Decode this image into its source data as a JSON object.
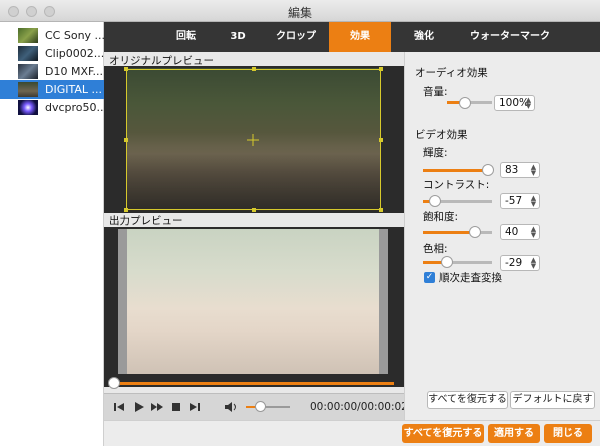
{
  "window": {
    "title": "編集"
  },
  "sidebar": {
    "clips": [
      {
        "name": "CC Sony ...",
        "selected": false
      },
      {
        "name": "Clip0002....",
        "selected": false
      },
      {
        "name": "D10 MXF....",
        "selected": false
      },
      {
        "name": "DIGITAL ...",
        "selected": true
      },
      {
        "name": "dvcpro50....",
        "selected": false
      }
    ]
  },
  "tabs": [
    {
      "label": "回転",
      "active": false
    },
    {
      "label": "3D",
      "active": false
    },
    {
      "label": "クロップ",
      "active": false
    },
    {
      "label": "効果",
      "active": true
    },
    {
      "label": "強化",
      "active": false
    },
    {
      "label": "ウォーターマーク",
      "active": false
    }
  ],
  "preview": {
    "original_label": "オリジナルプレビュー",
    "output_label": "出力プレビュー",
    "scrub_position_percent": 0,
    "volume_percent": 30,
    "timecode": "00:00:00/00:00:02"
  },
  "audio": {
    "section_title": "オーディオ効果",
    "volume_label": "音量:",
    "volume_value": "100%"
  },
  "video": {
    "section_title": "ビデオ効果",
    "brightness_label": "輝度:",
    "brightness_value": "83",
    "contrast_label": "コントラスト:",
    "contrast_value": "-57",
    "saturation_label": "飽和度:",
    "saturation_value": "40",
    "hue_label": "色相:",
    "hue_value": "-29",
    "deinterlace_label": "順次走査変換",
    "deinterlace_checked": true
  },
  "panel_buttons": {
    "restore_all": "すべてを復元する",
    "default_restore": "デフォルトに戻す"
  },
  "footer": {
    "restore_all": "すべてを復元する",
    "apply": "適用する",
    "close": "閉じる"
  },
  "colors": {
    "accent": "#ec7f13",
    "selection": "#2f7fd7",
    "tabbar": "#353535"
  }
}
